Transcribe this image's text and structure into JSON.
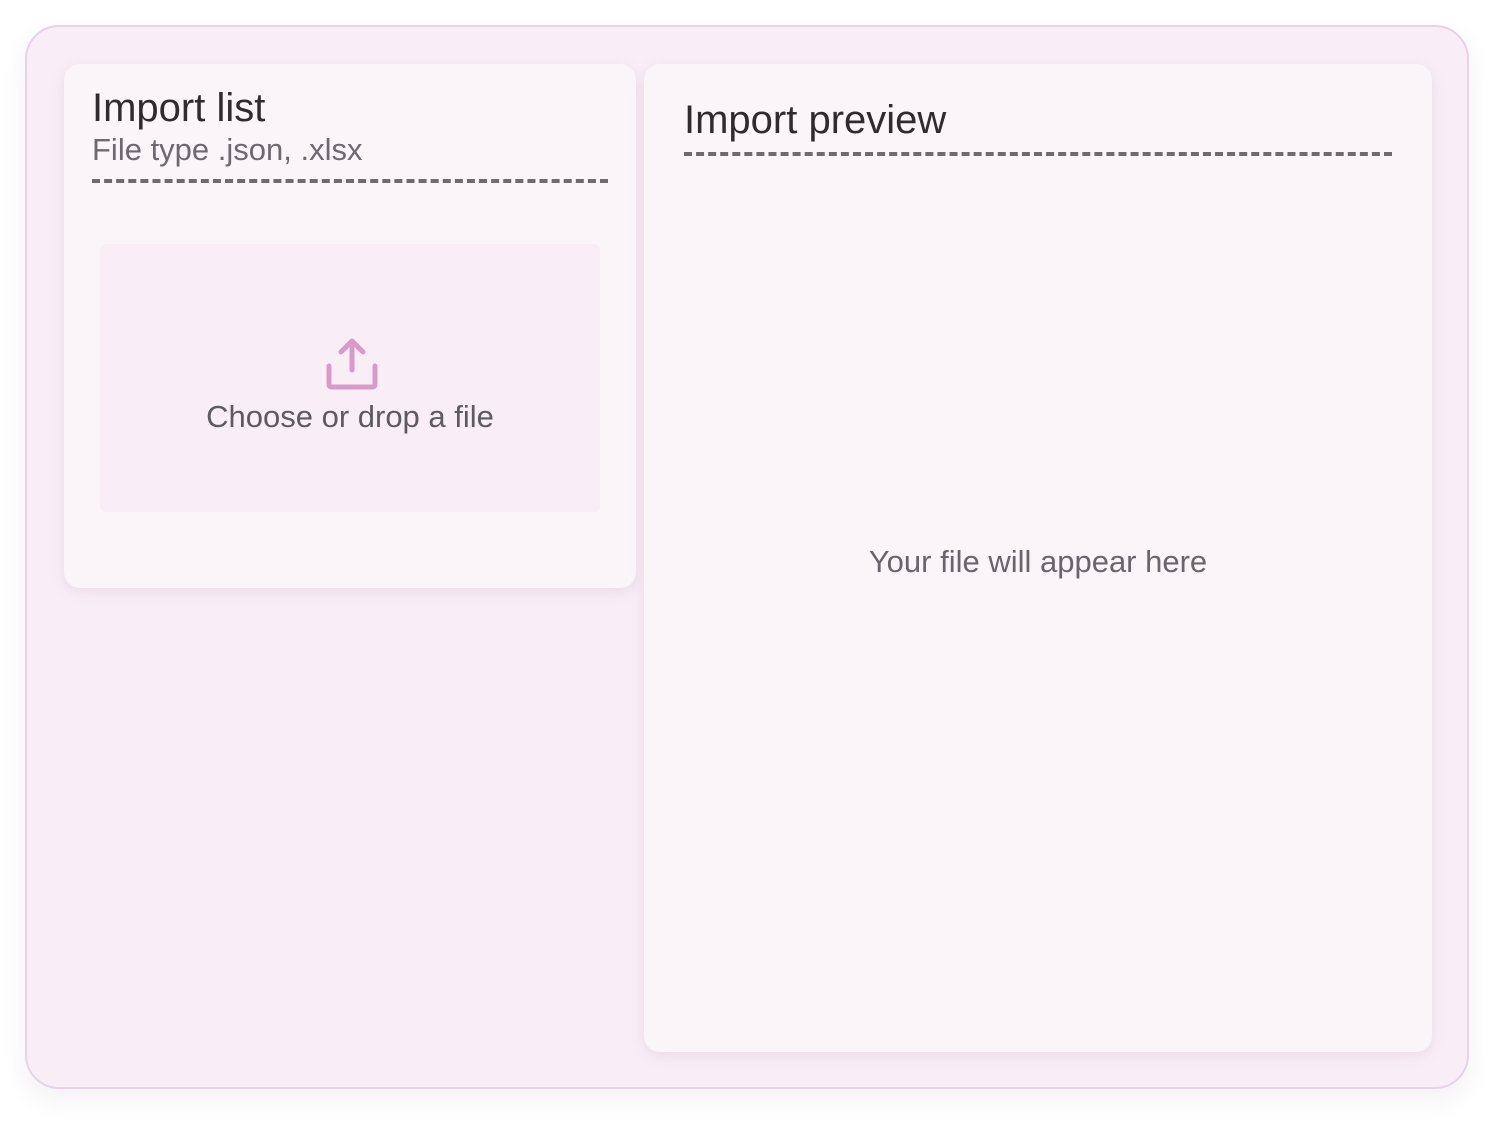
{
  "import_list": {
    "title": "Import list",
    "file_types": "File type .json, .xlsx",
    "dropzone_label": "Choose or drop a file",
    "icon": "upload-icon"
  },
  "import_preview": {
    "title": "Import preview",
    "empty_state": "Your file will appear here"
  },
  "colors": {
    "background": "#f9eef6",
    "card": "#fbf5fa",
    "accent": "#d89ac8",
    "text": "#2f2b2f"
  }
}
